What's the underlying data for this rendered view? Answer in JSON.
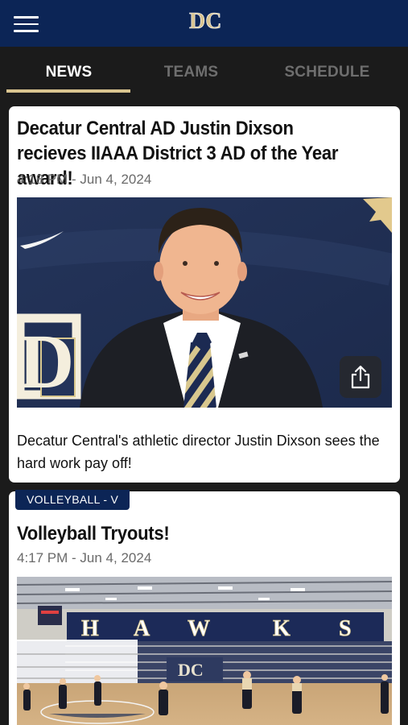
{
  "header": {
    "menu_icon": "hamburger-menu-icon",
    "logo_icon": "dc-logo-icon",
    "logo_text": "DC",
    "brand_navy": "#0c2556",
    "brand_gold": "#d9c48f"
  },
  "tabs": [
    {
      "label": "NEWS",
      "active": true
    },
    {
      "label": "TEAMS",
      "active": false
    },
    {
      "label": "SCHEDULE",
      "active": false
    }
  ],
  "articles": [
    {
      "title": "Decatur Central AD Justin Dixson recieves IIAAA District 3 AD of the Year award!",
      "date": "4:18 PM - Jun 4, 2024",
      "summary": "Decatur Central's athletic director Justin Dixson sees the hard work pay off!",
      "image_icon": "portrait-photo",
      "share_icon": "share-icon"
    },
    {
      "category": "VOLLEYBALL - V",
      "title": "Volleyball Tryouts!",
      "date": "4:17 PM - Jun 4, 2024",
      "image_icon": "gym-photo",
      "banner_letters": [
        "H",
        "A",
        "W",
        "K",
        "S"
      ]
    }
  ]
}
